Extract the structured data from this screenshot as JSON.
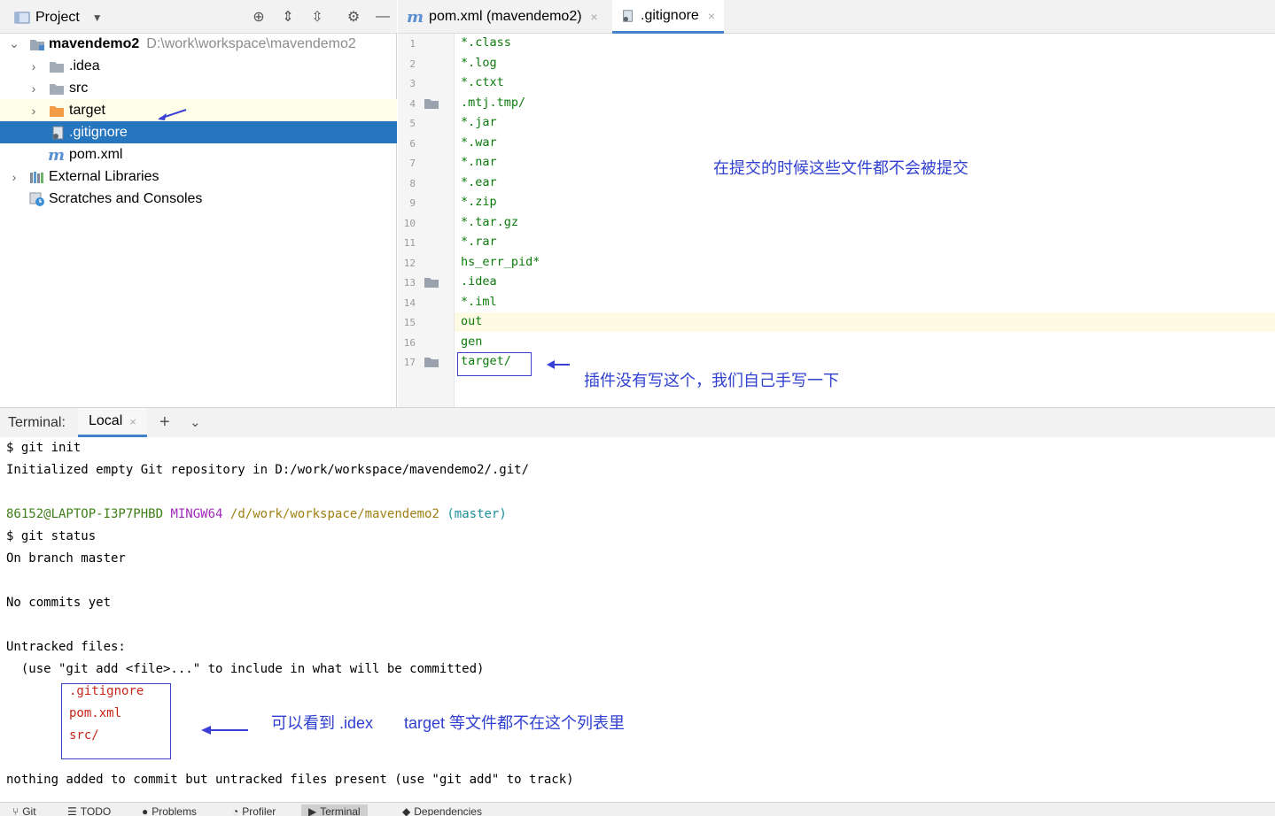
{
  "project": {
    "title": "Project",
    "tree": [
      {
        "label": "mavendemo2",
        "path": "D:\\work\\workspace\\mavendemo2",
        "icon": "module-folder-icon",
        "expanded": true
      },
      {
        "label": ".idea",
        "icon": "folder-icon"
      },
      {
        "label": "src",
        "icon": "folder-icon"
      },
      {
        "label": "target",
        "icon": "excluded-folder-icon"
      },
      {
        "label": ".gitignore",
        "icon": "gitignore-file-icon",
        "selected": true
      },
      {
        "label": "pom.xml",
        "icon": "maven-icon"
      },
      {
        "label": "External Libraries",
        "icon": "libraries-icon"
      },
      {
        "label": "Scratches and Consoles",
        "icon": "scratches-icon"
      }
    ]
  },
  "editor": {
    "tabs": [
      {
        "label": "pom.xml (mavendemo2)",
        "icon": "maven-icon",
        "active": false
      },
      {
        "label": ".gitignore",
        "icon": "gitignore-file-icon",
        "active": true
      }
    ],
    "lines": [
      "*.class",
      "*.log",
      "*.ctxt",
      ".mtj.tmp/",
      "*.jar",
      "*.war",
      "*.nar",
      "*.ear",
      "*.zip",
      "*.tar.gz",
      "*.rar",
      "hs_err_pid*",
      ".idea",
      "*.iml",
      "out",
      "gen",
      "target/"
    ],
    "line_numbers": [
      "1",
      "2",
      "3",
      "4",
      "5",
      "6",
      "7",
      "8",
      "9",
      "10",
      "11",
      "12",
      "13",
      "14",
      "15",
      "16",
      "17"
    ],
    "current_line": "15",
    "annotation_top": "在提交的时候这些文件都不会被提交",
    "annotation_target": "插件没有写这个，我们自己手写一下"
  },
  "terminal": {
    "label": "Terminal:",
    "tab": "Local",
    "cmd_init": "$ git init",
    "init_output": "Initialized empty Git repository in D:/work/workspace/mavendemo2/.git/",
    "prompt_user": "86152@LAPTOP-I3P7PHBD",
    "prompt_shell": "MINGW64",
    "prompt_path": "/d/work/workspace/mavendemo2",
    "prompt_branch": "(master)",
    "cmd_status": "$ git status",
    "on_branch": "On branch master",
    "no_commits": "No commits yet",
    "untracked_header": "Untracked files:",
    "untracked_hint": "  (use \"git add <file>...\" to include in what will be committed)",
    "untracked_files": [
      ".gitignore",
      "pom.xml",
      "src/"
    ],
    "nothing_added": "nothing added to commit but untracked files present (use \"git add\" to track)",
    "annotation_list_a": "可以看到 .idex",
    "annotation_list_b": "target  等文件都不在这个列表里"
  },
  "statusbar": {
    "items": [
      {
        "label": "Git",
        "icon": "git-icon"
      },
      {
        "label": "TODO",
        "icon": "todo-icon"
      },
      {
        "label": "Problems",
        "icon": "problems-icon"
      },
      {
        "label": "Profiler",
        "icon": "profiler-icon"
      },
      {
        "label": "Terminal",
        "icon": "terminal-icon",
        "active": true
      },
      {
        "label": "Dependencies",
        "icon": "dependencies-icon"
      }
    ]
  }
}
